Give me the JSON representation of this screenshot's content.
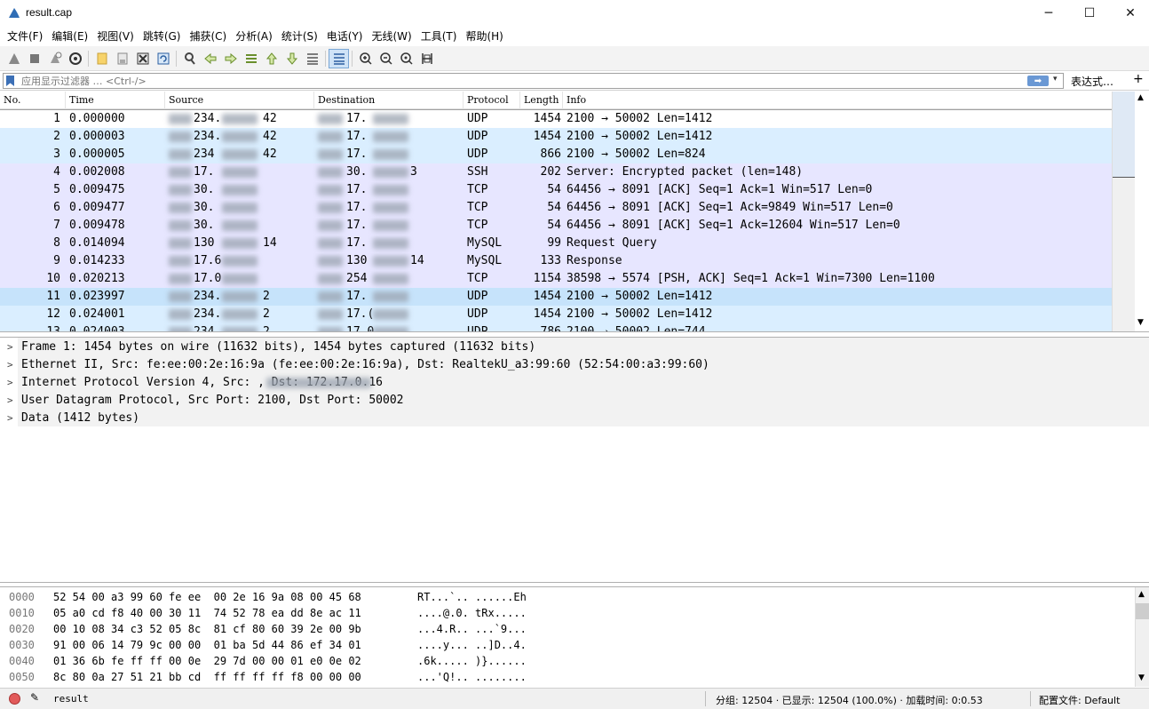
{
  "window": {
    "title": "result.cap",
    "minimize_glyph": "─",
    "maximize_glyph": "☐",
    "close_glyph": "✕"
  },
  "menu": [
    "文件(F)",
    "编辑(E)",
    "视图(V)",
    "跳转(G)",
    "捕获(C)",
    "分析(A)",
    "统计(S)",
    "电话(Y)",
    "无线(W)",
    "工具(T)",
    "帮助(H)"
  ],
  "toolbar": {
    "icons": [
      "shark-fin-start-icon",
      "stop-icon",
      "restart-icon",
      "capture-options-icon",
      "open-file-icon",
      "save-file-icon",
      "close-file-icon",
      "reload-file-icon",
      "find-packet-icon",
      "go-back-icon",
      "go-forward-icon",
      "go-to-packet-icon",
      "first-packet-icon",
      "last-packet-icon",
      "auto-scroll-icon",
      "colorize-icon",
      "zoom-in-icon",
      "zoom-out-icon",
      "zoom-reset-icon",
      "resize-columns-icon"
    ]
  },
  "filter": {
    "placeholder": "应用显示过滤器 … <Ctrl-/>",
    "apply_glyph": "➡",
    "dropdown_glyph": "▾",
    "expression_label": "表达式…",
    "plus_label": "+"
  },
  "packet_list": {
    "columns": [
      "No.",
      "Time",
      "Source",
      "Destination",
      "Protocol",
      "Length",
      "Info"
    ],
    "rows": [
      {
        "no": "1",
        "time": "0.000000",
        "src": "234.",
        "src_tail": "42",
        "dst": "17.",
        "proto": "UDP",
        "len": "1454",
        "info": "2100 → 50002 Len=1412",
        "color": "#ffffff",
        "selected": true
      },
      {
        "no": "2",
        "time": "0.000003",
        "src": "234.",
        "src_tail": "42",
        "dst": "17.",
        "proto": "UDP",
        "len": "1454",
        "info": "2100 → 50002 Len=1412",
        "color": "#daeeff",
        "selected": false
      },
      {
        "no": "3",
        "time": "0.000005",
        "src": "234",
        "src_tail": "42",
        "dst": "17.",
        "proto": "UDP",
        "len": "866",
        "info": "2100 → 50002 Len=824",
        "color": "#daeeff",
        "selected": false
      },
      {
        "no": "4",
        "time": "0.002008",
        "src": "17.",
        "src_tail": "",
        "dst": "30.",
        "dst_tail": "3",
        "proto": "SSH",
        "len": "202",
        "info": "Server: Encrypted packet (len=148)",
        "color": "#e7e6ff",
        "selected": false
      },
      {
        "no": "5",
        "time": "0.009475",
        "src": "30.",
        "src_tail": "",
        "dst": "17.",
        "proto": "TCP",
        "len": "54",
        "info": "64456 → 8091 [ACK] Seq=1 Ack=1 Win=517 Len=0",
        "color": "#e7e6ff",
        "selected": false
      },
      {
        "no": "6",
        "time": "0.009477",
        "src": "30.",
        "src_tail": "",
        "dst": "17.",
        "proto": "TCP",
        "len": "54",
        "info": "64456 → 8091 [ACK] Seq=1 Ack=9849 Win=517 Len=0",
        "color": "#e7e6ff",
        "selected": false
      },
      {
        "no": "7",
        "time": "0.009478",
        "src": "30.",
        "src_tail": "",
        "dst": "17.",
        "proto": "TCP",
        "len": "54",
        "info": "64456 → 8091 [ACK] Seq=1 Ack=12604 Win=517 Len=0",
        "color": "#e7e6ff",
        "selected": false
      },
      {
        "no": "8",
        "time": "0.014094",
        "src": "130",
        "src_tail": "14",
        "dst": "17.",
        "proto": "MySQL",
        "len": "99",
        "info": "Request Query",
        "color": "#e7e6ff",
        "selected": false
      },
      {
        "no": "9",
        "time": "0.014233",
        "src": "17.6",
        "src_tail": "",
        "dst": "130",
        "dst_tail": "14",
        "proto": "MySQL",
        "len": "133",
        "info": "Response",
        "color": "#e7e6ff",
        "selected": false
      },
      {
        "no": "10",
        "time": "0.020213",
        "src": "17.0",
        "src_tail": "",
        "dst": "254",
        "proto": "TCP",
        "len": "1154",
        "info": "38598 → 5574 [PSH, ACK] Seq=1 Ack=1 Win=7300 Len=1100",
        "color": "#e7e6ff",
        "selected": false
      },
      {
        "no": "11",
        "time": "0.023997",
        "src": "234.",
        "src_tail": "2",
        "dst": "17.",
        "proto": "UDP",
        "len": "1454",
        "info": "2100 → 50002 Len=1412",
        "color": "#c6e3fb",
        "selected": false
      },
      {
        "no": "12",
        "time": "0.024001",
        "src": "234.",
        "src_tail": "2",
        "dst": "17.(",
        "proto": "UDP",
        "len": "1454",
        "info": "2100 → 50002 Len=1412",
        "color": "#daeeff",
        "selected": false
      },
      {
        "no": "13",
        "time": "0.024003",
        "src": "234.",
        "src_tail": "2",
        "dst": "17.0",
        "proto": "UDP",
        "len": "786",
        "info": "2100 → 50002 Len=744",
        "color": "#daeeff",
        "selected": false
      }
    ]
  },
  "details": [
    "Frame 1: 1454 bytes on wire (11632 bits), 1454 bytes captured (11632 bits)",
    "Ethernet II, Src: fe:ee:00:2e:16:9a (fe:ee:00:2e:16:9a), Dst: RealtekU_a3:99:60 (52:54:00:a3:99:60)",
    "Internet Protocol Version 4, Src:                , Dst: 172.17.0.16",
    "User Datagram Protocol, Src Port: 2100, Dst Port: 50002",
    "Data (1412 bytes)"
  ],
  "hex": [
    {
      "off": "0000",
      "bytes": "52 54 00 a3 99 60 fe ee  00 2e 16 9a 08 00 45 68",
      "ascii": "RT...`.. ......Eh"
    },
    {
      "off": "0010",
      "bytes": "05 a0 cd f8 40 00 30 11  74 52 78 ea dd 8e ac 11",
      "ascii": "....@.0. tRx....."
    },
    {
      "off": "0020",
      "bytes": "00 10 08 34 c3 52 05 8c  81 cf 80 60 39 2e 00 9b",
      "ascii": "...4.R.. ...`9..."
    },
    {
      "off": "0030",
      "bytes": "91 00 06 14 79 9c 00 00  01 ba 5d 44 86 ef 34 01",
      "ascii": "....y... ..]D..4."
    },
    {
      "off": "0040",
      "bytes": "01 36 6b fe ff ff 00 0e  29 7d 00 00 01 e0 0e 02",
      "ascii": ".6k..... )}......"
    },
    {
      "off": "0050",
      "bytes": "8c 80 0a 27 51 21 bb cd  ff ff ff ff f8 00 00 00",
      "ascii": "...'Q!.. ........"
    }
  ],
  "status": {
    "file": "result",
    "stats": "分组: 12504 · 已显示: 12504 (100.0%) · 加载时间: 0:0.53",
    "profile": "配置文件: Default"
  },
  "colors": {
    "udp": "#daeeff",
    "tcp": "#e7e6ff",
    "selected_border": "#a0a0a0",
    "accent": "#6a98d4"
  }
}
